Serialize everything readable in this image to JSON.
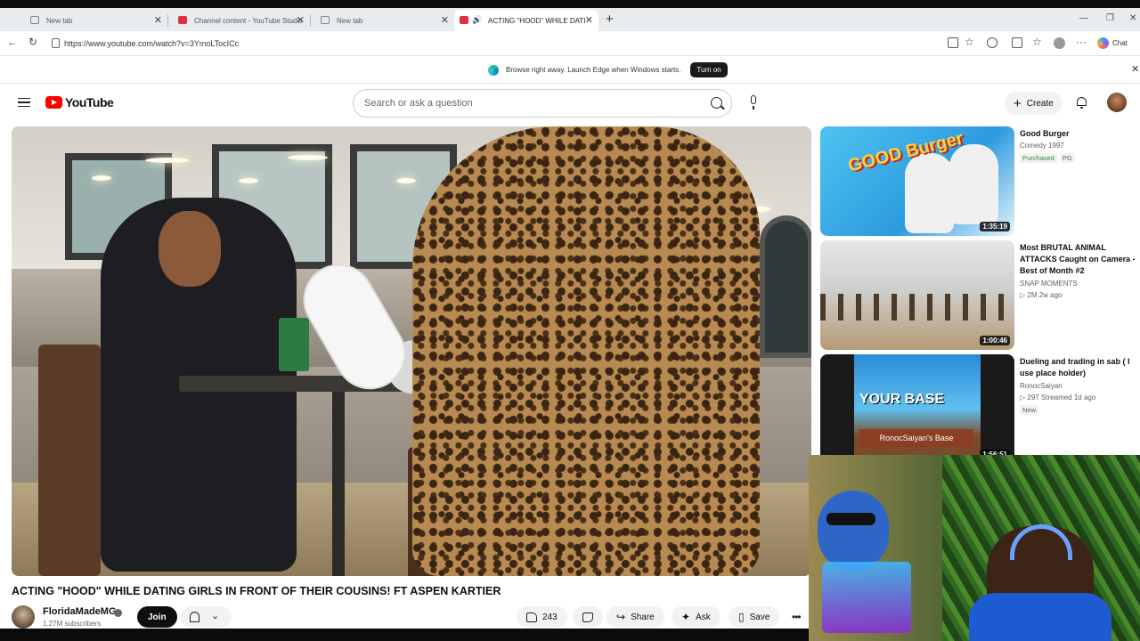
{
  "browser": {
    "tabs": [
      {
        "label": "New tab",
        "active": false
      },
      {
        "label": "Channel content - YouTube Studio",
        "active": false
      },
      {
        "label": "New tab",
        "active": false
      },
      {
        "label": "ACTING \"HOOD\" WHILE DATI",
        "active": true
      }
    ],
    "url": "https://www.youtube.com/watch?v=3YmoLTocICc",
    "chat_label": "Chat"
  },
  "edge_banner": {
    "message": "Browse right away. Launch Edge when Windows starts.",
    "button_label": "Turn on"
  },
  "youtube": {
    "logo_text": "YouTube",
    "search_placeholder": "Search or ask a question",
    "create_label": "Create"
  },
  "video": {
    "title": "ACTING \"HOOD\" WHILE DATING GIRLS IN FRONT OF THEIR COUSINS! FT ASPEN KARTIER",
    "channel": "FloridaMadeMG",
    "subscribers": "1.27M subscribers",
    "join_label": "Join",
    "likes": "243",
    "share_label": "Share",
    "ask_label": "Ask",
    "save_label": "Save"
  },
  "recommendations": [
    {
      "title": "Good Burger",
      "meta1": "Comedy 1997",
      "tags": [
        "Purchased",
        "PG"
      ],
      "duration": "1:35:19"
    },
    {
      "title": "Most BRUTAL ANIMAL ATTACKS Caught on Camera - Best of Month #2",
      "channel": "SNAP MOMENTS",
      "stats": "▷ 2M  2w ago",
      "duration": "1:00:46"
    },
    {
      "title": "Dueling and trading in sab ( I use place holder)",
      "channel": "RonocSaiyan",
      "stats": "▷ 297  Streamed 1d ago",
      "badge": "New",
      "duration": "1:56:51",
      "thumb_text": "YOUR BASE",
      "thumb_sign": "RonocSaiyan's Base"
    }
  ],
  "thumb1_logo": "GOOD Burger"
}
